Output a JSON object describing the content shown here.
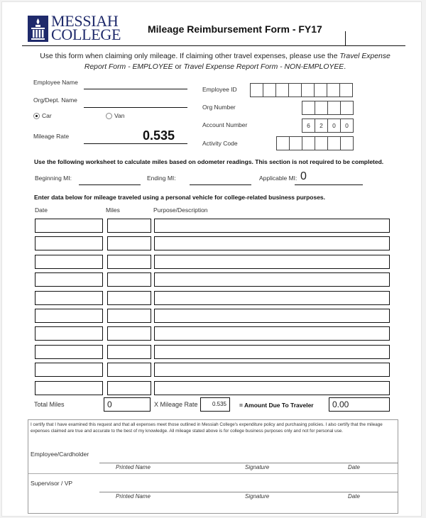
{
  "header": {
    "logo": {
      "line1": "MESSIAH",
      "line2": "COLLEGE",
      "icon": "torch-pillar-logo-icon",
      "color": "#1f2a6b"
    },
    "title": "Mileage Reimbursement Form - FY17"
  },
  "intro": {
    "text_plain": "Use this form when claiming only mileage.  If claiming other travel expenses, please use the ",
    "text_italic1": "Travel Expense Report Form - EMPLOYEE",
    "text_or": " or ",
    "text_italic2": "Travel Expense Report Form - NON-EMPLOYEE",
    "text_end": "."
  },
  "left_fields": {
    "employee_name": {
      "label": "Employee Name",
      "value": ""
    },
    "org_dept_name": {
      "label": "Org/Dept. Name",
      "value": ""
    },
    "vehicle": {
      "options": [
        "Car",
        "Van"
      ],
      "selected": "Car"
    },
    "mileage_rate": {
      "label": "Mileage Rate",
      "value": "0.535"
    }
  },
  "right_fields": {
    "employee_id": {
      "label": "Employee ID",
      "digits": [
        "",
        "",
        "",
        "",
        "",
        "",
        "",
        ""
      ]
    },
    "org_number": {
      "label": "Org Number",
      "digits": [
        "",
        "",
        "",
        ""
      ]
    },
    "account_number": {
      "label": "Account Number",
      "digits": [
        "6",
        "2",
        "0",
        "0"
      ]
    },
    "activity_code": {
      "label": "Activity Code",
      "digits": [
        "",
        "",
        "",
        "",
        "",
        ""
      ]
    }
  },
  "worksheet": {
    "instruction": "Use the following worksheet to calculate miles based on odometer readings. This section is not required to be completed.",
    "beginning": {
      "label": "Beginning MI:",
      "value": ""
    },
    "ending": {
      "label": "Ending MI:",
      "value": ""
    },
    "applicable": {
      "label": "Applicable MI:",
      "value": "0"
    }
  },
  "log": {
    "instruction": "Enter data below for mileage traveled using a personal vehicle for college-related business purposes.",
    "columns": [
      "Date",
      "Miles",
      "Purpose/Description"
    ],
    "rows": [
      {
        "date": "",
        "miles": "",
        "purpose": ""
      },
      {
        "date": "",
        "miles": "",
        "purpose": ""
      },
      {
        "date": "",
        "miles": "",
        "purpose": ""
      },
      {
        "date": "",
        "miles": "",
        "purpose": ""
      },
      {
        "date": "",
        "miles": "",
        "purpose": ""
      },
      {
        "date": "",
        "miles": "",
        "purpose": ""
      },
      {
        "date": "",
        "miles": "",
        "purpose": ""
      },
      {
        "date": "",
        "miles": "",
        "purpose": ""
      },
      {
        "date": "",
        "miles": "",
        "purpose": ""
      },
      {
        "date": "",
        "miles": "",
        "purpose": ""
      }
    ]
  },
  "totals": {
    "total_miles_label": "Total Miles",
    "total_miles": "0",
    "rate_label": "X Mileage Rate",
    "rate": "0.535",
    "amount_label": "= Amount Due To Traveler",
    "amount": "0.00"
  },
  "certification": {
    "text": "I certify that I have examined this request and that all expenses meet those outlined in Messiah College's expenditure policy and purchasing policies.  I also certify that the mileage expenses claimed are true and accurate to the best of my knowledge.  All mileage stated above is for college business purposes only and not for personal use.",
    "signers": [
      {
        "role": "Employee/Cardholder",
        "captions": [
          "Printed Name",
          "Signature",
          "Date"
        ]
      },
      {
        "role": "Supervisor / VP",
        "captions": [
          "Printed Name",
          "Signature",
          "Date"
        ]
      }
    ]
  }
}
